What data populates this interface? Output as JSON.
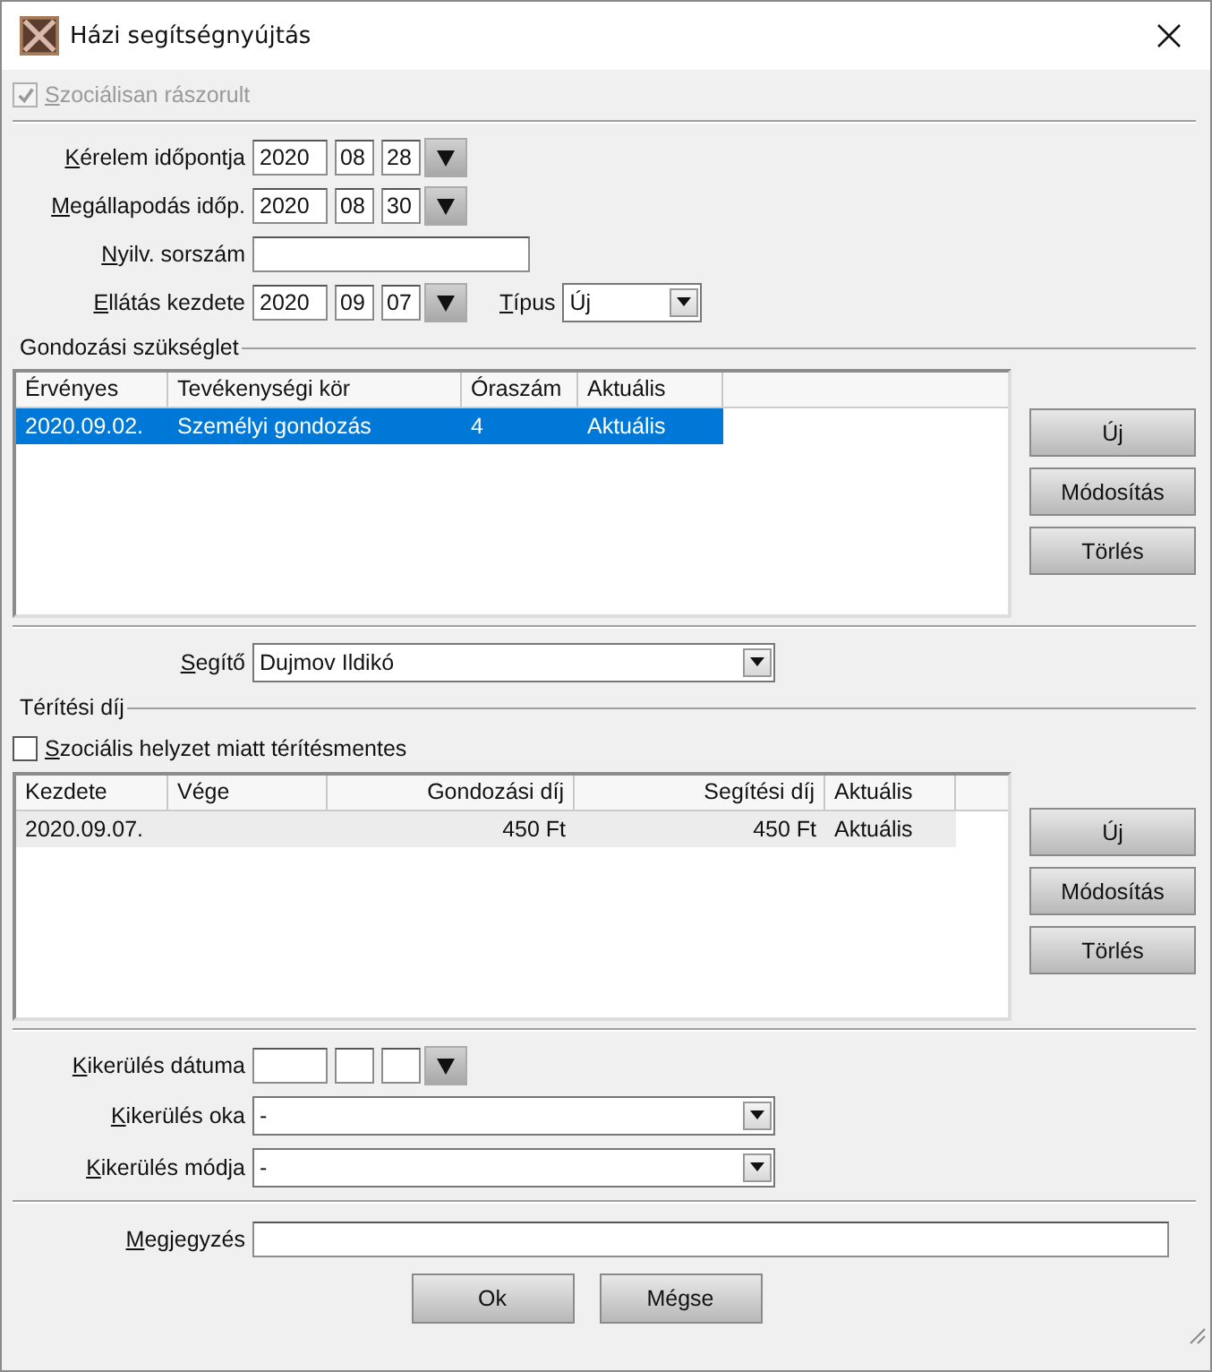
{
  "window": {
    "title": "Házi segítségnyújtás"
  },
  "social_need": {
    "label": "Szociálisan rászorult",
    "checked": true,
    "disabled": true
  },
  "dates": [
    {
      "label": "Kérelem időpontja",
      "year": "2020",
      "month": "08",
      "day": "28"
    },
    {
      "label": "Megállapodás időp.",
      "year": "2020",
      "month": "08",
      "day": "30"
    }
  ],
  "serial": {
    "label": "Nyilv. sorszám"
  },
  "start": {
    "label": "Ellátás kezdete",
    "year": "2020",
    "month": "09",
    "day": "07",
    "type": {
      "label": "Típus",
      "value": "Új"
    }
  },
  "care_needs": {
    "title": "Gondozási szükséglet",
    "focused": true,
    "columns": [
      "Érvényes",
      "Tevékenységi kör",
      "Óraszám",
      "Aktuális"
    ],
    "rows": [
      {
        "cells": [
          "2020.09.02.",
          "Személyi gondozás",
          "4",
          "Aktuális"
        ],
        "selected": true
      }
    ],
    "buttons": [
      "Új",
      "Módosítás",
      "Törlés"
    ]
  },
  "helper": {
    "label": "Segítő",
    "value": "Dujmov Ildikó"
  },
  "fees": {
    "title": "Térítési díj",
    "exempt": {
      "label": "Szociális helyzet miatt térítésmentes",
      "checked": false
    },
    "focused": false,
    "columns": [
      "Kezdete",
      "Vége",
      "Gondozási díj",
      "Segítési díj",
      "Aktuális"
    ],
    "rows": [
      {
        "cells": [
          "2020.09.07.",
          "",
          "450 Ft",
          "450 Ft",
          "Aktuális"
        ],
        "selected": true
      }
    ],
    "buttons": [
      "Új",
      "Módosítás",
      "Törlés"
    ]
  },
  "exit": {
    "date_label": "Kikerülés dátuma",
    "reason": {
      "label": "Kikerülés oka",
      "value": "-"
    },
    "mode": {
      "label": "Kikerülés módja",
      "value": "-"
    }
  },
  "note": {
    "label": "Megjegyzés"
  },
  "buttons": [
    "Ok",
    "Mégse"
  ]
}
